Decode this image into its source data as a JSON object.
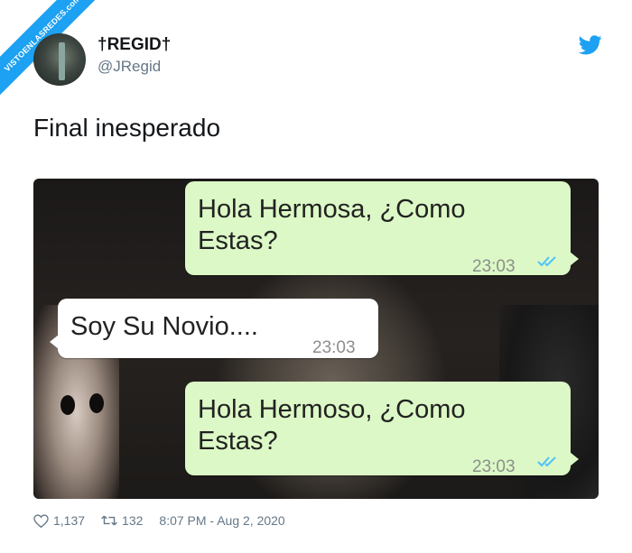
{
  "watermark": {
    "text": "VISTOENLASREDES",
    "sub": ".com"
  },
  "user": {
    "name": "†REGID†",
    "handle": "@JRegid"
  },
  "tweet": {
    "text": "Final inesperado"
  },
  "chat": [
    {
      "direction": "out",
      "text_line1": "Hola Hermosa, ¿Como",
      "text_line2": "Estas?",
      "time": "23:03"
    },
    {
      "direction": "in",
      "text_line1": "Soy Su Novio....",
      "time": "23:03"
    },
    {
      "direction": "out",
      "text_line1": "Hola Hermoso, ¿Como",
      "text_line2": "Estas?",
      "time": "23:03"
    }
  ],
  "stats": {
    "likes": "1,137",
    "retweets": "132",
    "timestamp": "8:07 PM - Aug 2, 2020"
  },
  "colors": {
    "accent": "#1da1f2",
    "outgoing_bubble": "#dcf8c6",
    "incoming_bubble": "#ffffff",
    "read_ticks": "#4fc3f7"
  },
  "icons": {
    "brand": "twitter-bird-icon",
    "like": "heart-icon",
    "retweet": "retweet-icon",
    "read": "double-check-icon"
  }
}
